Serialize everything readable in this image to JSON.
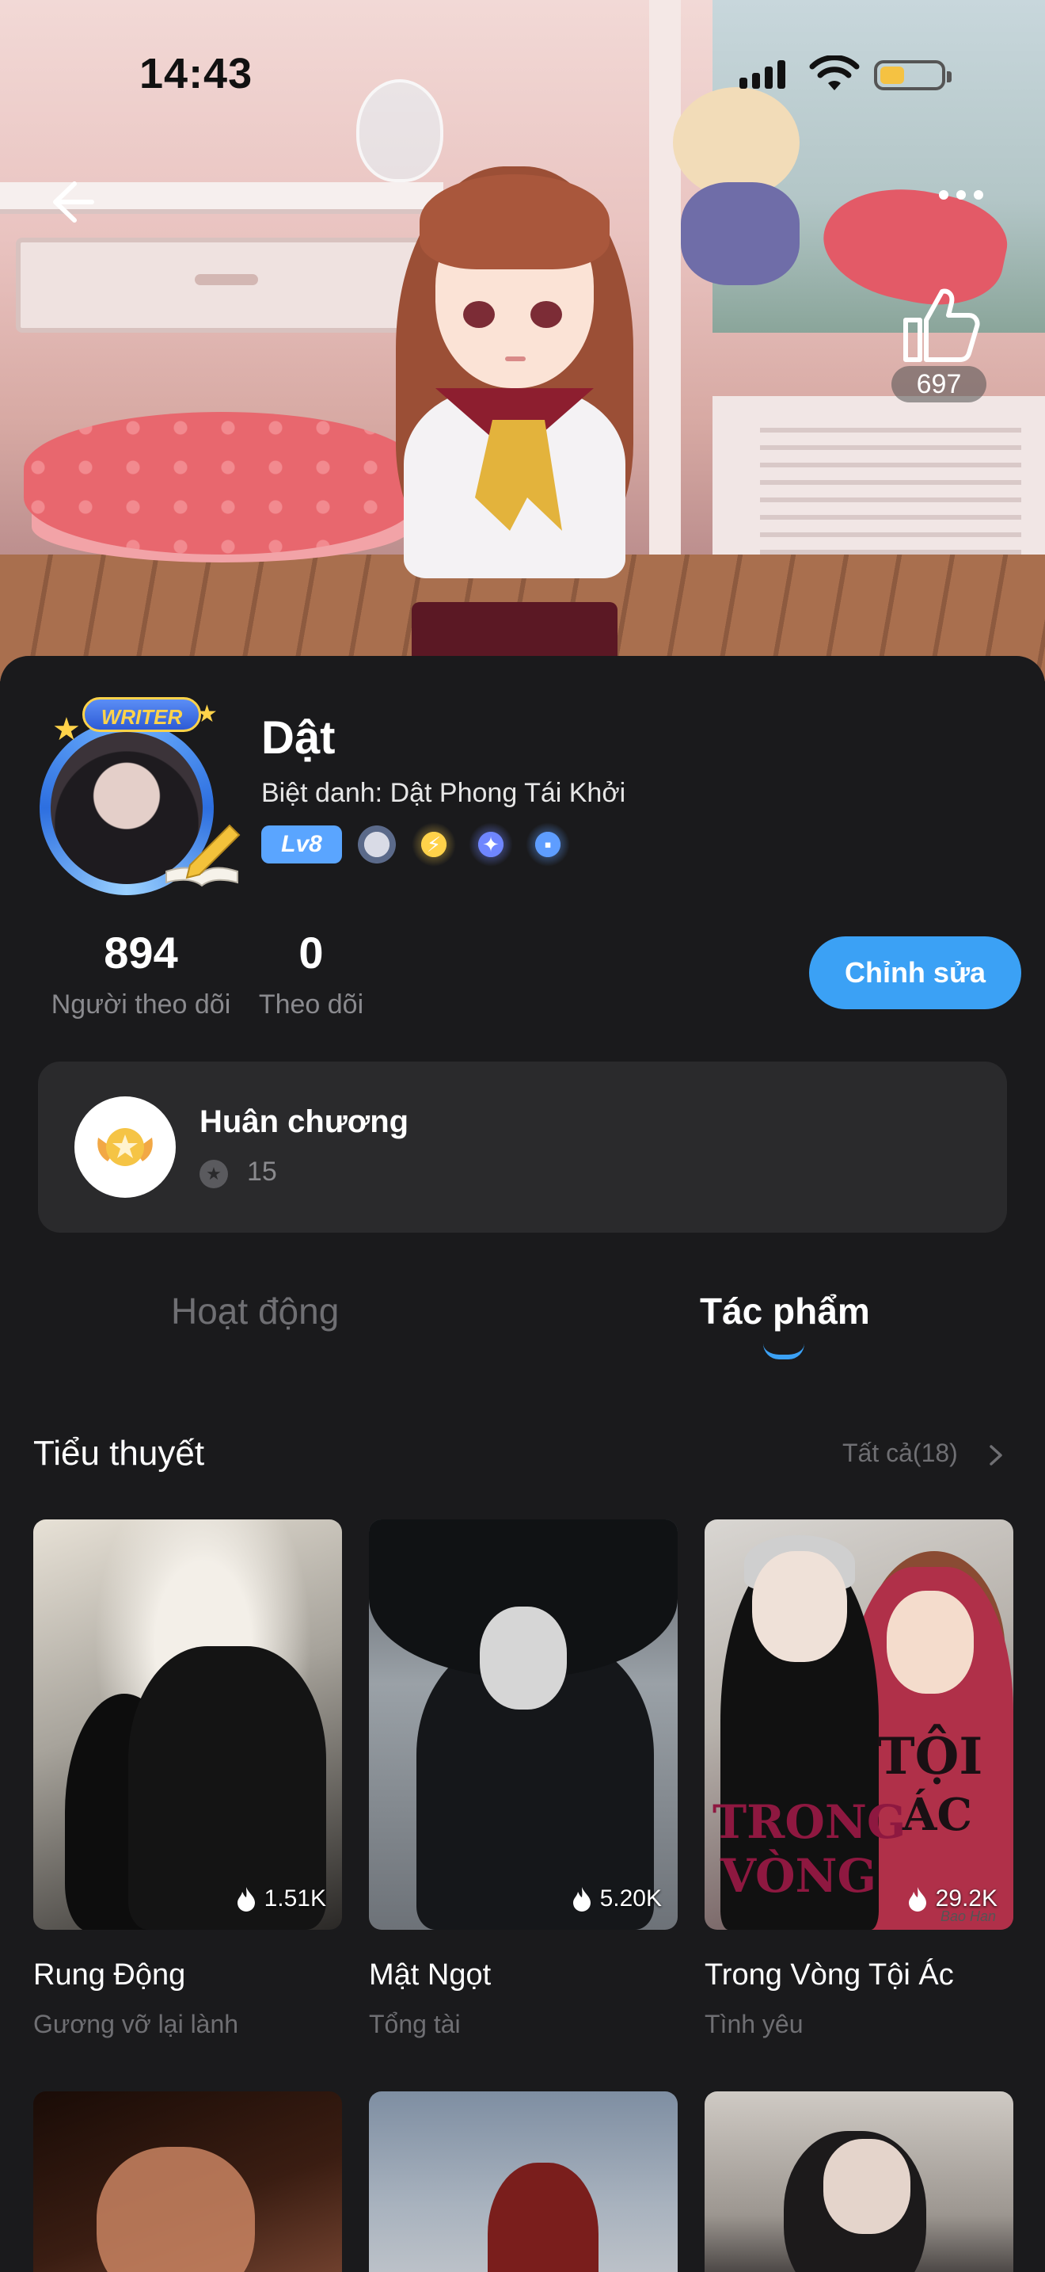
{
  "status_bar": {
    "time": "14:43"
  },
  "hero": {
    "like_count": "697"
  },
  "profile": {
    "writer_label": "WRITER",
    "name": "Dật",
    "nickname": "Biệt danh: Dật Phong Tái Khởi",
    "level": "Lv8",
    "stats": [
      {
        "value": "894",
        "label": "Người theo dõi"
      },
      {
        "value": "0",
        "label": "Theo dõi"
      }
    ],
    "edit_label": "Chỉnh sửa"
  },
  "medal_card": {
    "title": "Huân chương",
    "count": "15"
  },
  "tabs": [
    {
      "label": "Hoạt động",
      "active": false
    },
    {
      "label": "Tác phẩm",
      "active": true
    }
  ],
  "novels": {
    "title": "Tiểu thuyết",
    "all_label": "Tất cả(18)",
    "items": [
      {
        "title": "Rung Động",
        "tag": "Gương vỡ lại lành",
        "heat": "1.51K"
      },
      {
        "title": "Mật Ngọt",
        "tag": "Tổng tài",
        "heat": "5.20K"
      },
      {
        "title": "Trong Vòng Tội Ác",
        "tag": "Tình yêu",
        "heat": "29.2K",
        "cover_text": [
          "TỘI",
          "TRONG",
          "ÁC",
          "VÒNG"
        ],
        "cover_signature": "Bao Han"
      }
    ]
  },
  "colors": {
    "accent": "#3ba1f5",
    "background": "#1a1a1c",
    "card": "#2a2a2c",
    "muted": "#6f6f73"
  },
  "icons": [
    "back-arrow-icon",
    "more-icon",
    "thumbs-up-icon",
    "signal-icon",
    "wifi-icon",
    "battery-icon",
    "medal-icon",
    "flame-icon",
    "chevron-right-icon"
  ]
}
